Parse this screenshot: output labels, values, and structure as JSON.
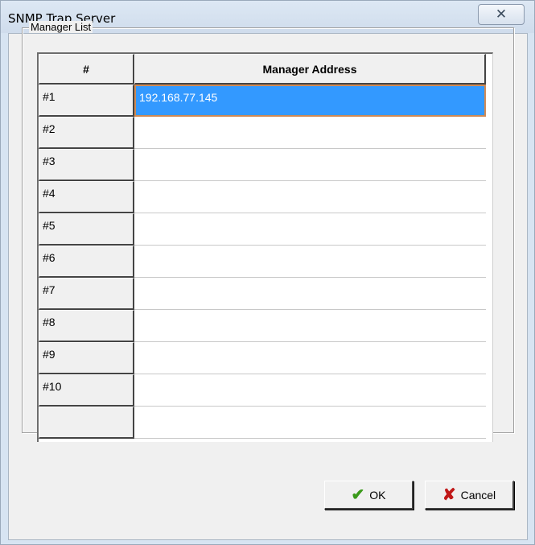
{
  "window": {
    "title": "SNMP Trap Server",
    "close_glyph": "✕"
  },
  "group": {
    "label": "Manager List"
  },
  "table": {
    "headers": [
      "#",
      "Manager Address"
    ],
    "rows": [
      {
        "num": "#1",
        "address": "192.168.77.145",
        "selected": true
      },
      {
        "num": "#2",
        "address": ""
      },
      {
        "num": "#3",
        "address": ""
      },
      {
        "num": "#4",
        "address": ""
      },
      {
        "num": "#5",
        "address": ""
      },
      {
        "num": "#6",
        "address": ""
      },
      {
        "num": "#7",
        "address": ""
      },
      {
        "num": "#8",
        "address": ""
      },
      {
        "num": "#9",
        "address": ""
      },
      {
        "num": "#10",
        "address": ""
      }
    ]
  },
  "buttons": {
    "ok_label": "OK",
    "ok_icon": "checkmark-icon",
    "cancel_label": "Cancel",
    "cancel_icon": "x-mark-icon"
  },
  "colors": {
    "selection": "#3399ff",
    "ok_icon": "#3a9a1a",
    "cancel_icon": "#c01818"
  }
}
